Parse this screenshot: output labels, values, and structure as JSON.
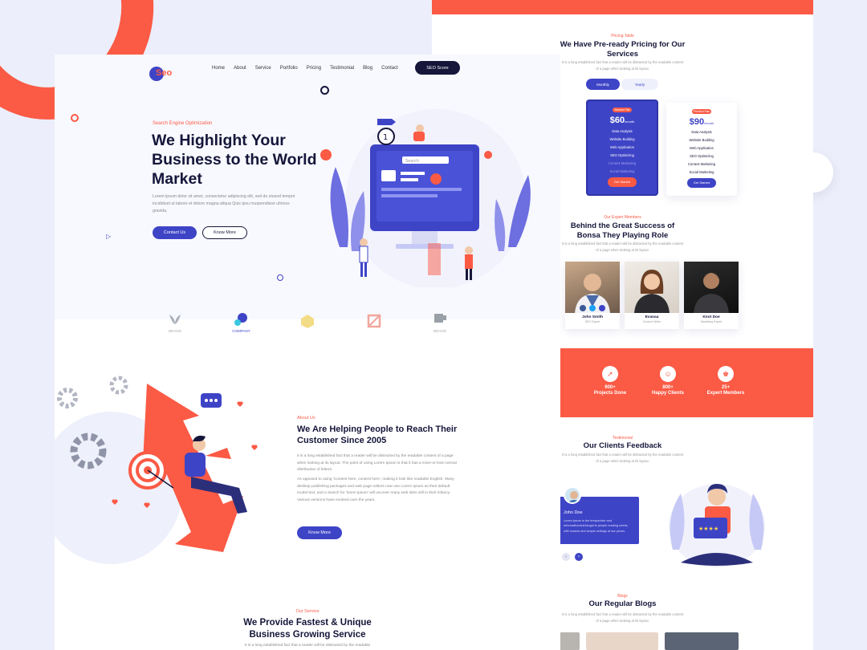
{
  "nav": {
    "logo": "Seo",
    "links": [
      "Home",
      "About",
      "Service",
      "Portfolio",
      "Pricing",
      "Testimonial",
      "Blog",
      "Contact"
    ],
    "cta": "SEO Score"
  },
  "hero": {
    "eyebrow": "Search Engine Optimization",
    "title": "We Highlight Your Business to the World Market",
    "description": "Lorem ipsum dolor sit amet, consectetur adipiscing elit, sed do eiusod tempor incididunt ut labore et dolore magna aliqua Quis ipsu muspendisse ultrices gravida.",
    "primary_btn": "Contact Us",
    "secondary_btn": "Know More",
    "search_placeholder": "Search"
  },
  "brands": [
    "BRAND",
    "COMPANY",
    "",
    "",
    "BRAND"
  ],
  "about": {
    "eyebrow": "About Us",
    "title": "We Are Helping People to Reach Their Customer Since 2005",
    "p1": "It is a long established fact that a reader will be distracted by the readable content of a page when looking at its layout. The point of using Lorem Ipsum is that it has a more-or-less normal distribution of letters.",
    "p2": "As opposed to using 'Content here, content here', making it look like readable English. Many desktop publishing packages and web page editors now use Lorem Ipsum as their default model text, and a search for 'lorem ipsum' will uncover many web sites still in their infancy. Various versions have evolved over the years.",
    "btn": "Know More"
  },
  "service": {
    "eyebrow": "Our Service",
    "title": "We Provide Fastest & Unique Business Growing Service",
    "desc": "It is a long established fact that a reader will be distracted by the readable"
  },
  "pricing": {
    "eyebrow": "Pricing Table",
    "title": "We Have Pre-ready Pricing for Our Services",
    "desc": "It is a long established fact that a reader will be distracted by the readable content of a page when looking at its layout.",
    "tabs": [
      "Monthly",
      "Yearly"
    ],
    "plans": [
      {
        "badge": "Standard Plan",
        "price": "$60",
        "period": "/month",
        "features": [
          "Data Analysis",
          "Website Building",
          "Web Application",
          "SEO Optimizing",
          "Content Marketing",
          "Social Marketing"
        ],
        "btn": "Get Started"
      },
      {
        "badge": "Premium Plan",
        "price": "$90",
        "period": "/month",
        "features": [
          "Data Analysis",
          "Website Building",
          "Web Application",
          "SEO Optimizing",
          "Content Marketing",
          "Social Marketing"
        ],
        "btn": "Get Started"
      }
    ]
  },
  "team": {
    "eyebrow": "Our Expert Members",
    "title": "Behind the Great Success of Bonsa They Playing Role",
    "desc": "It is a long established fact that a reader will be distracted by the readable content of a page when looking at its layout.",
    "members": [
      {
        "name": "John Smith",
        "role": "SEO Expert"
      },
      {
        "name": "Evanaa",
        "role": "Content Writer"
      },
      {
        "name": "Knot Doe",
        "role": "Marketing Expert"
      }
    ]
  },
  "stats": [
    {
      "value": "900+",
      "label": "Projects Done"
    },
    {
      "value": "800+",
      "label": "Happy Clients"
    },
    {
      "value": "25+",
      "label": "Expert Members"
    }
  ],
  "testimonial": {
    "eyebrow": "Testimonial",
    "title": "Our Clients Feedback",
    "desc": "It is a long established fact that a reader will be distracted by the readable content of a page when looking at its layout.",
    "name": "John Doe",
    "text": "Lorem ipsum is the irrespective and reformattocotutricingal to people reading needs, with modest and simple settings at low prices."
  },
  "blog": {
    "eyebrow": "Blogs",
    "title": "Our Regular Blogs",
    "desc": "It is a long established fact that a reader will be distracted by the readable content of a page when looking at its layout."
  },
  "colors": {
    "primary": "#3e44c6",
    "accent": "#fb5a45",
    "dark": "#15163a",
    "bg": "#eceefb"
  }
}
